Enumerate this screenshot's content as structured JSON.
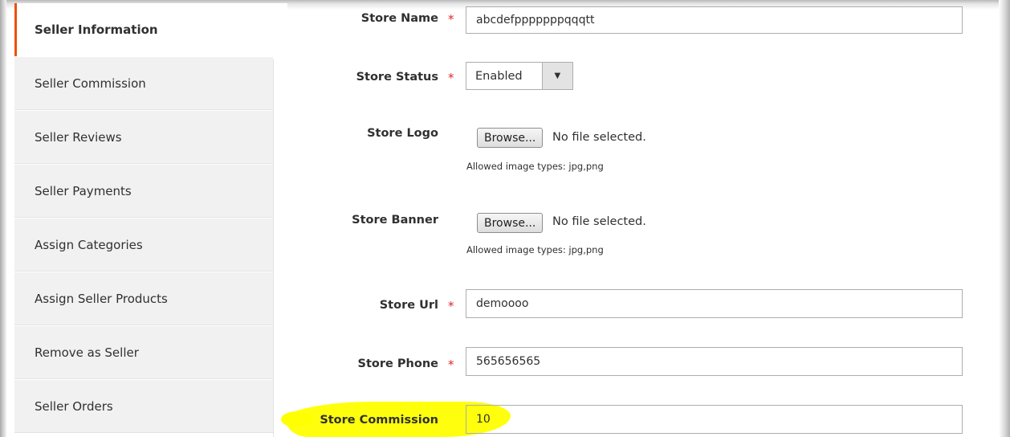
{
  "sidebar": {
    "items": [
      {
        "label": "Seller Information",
        "active": true
      },
      {
        "label": "Seller Commission"
      },
      {
        "label": "Seller Reviews"
      },
      {
        "label": "Seller Payments"
      },
      {
        "label": "Assign Categories"
      },
      {
        "label": "Assign Seller Products"
      },
      {
        "label": "Remove as Seller"
      },
      {
        "label": "Seller Orders"
      }
    ]
  },
  "form": {
    "store_name": {
      "label": "Store Name",
      "value": "abcdefpppppppqqqtt",
      "required": true
    },
    "store_status": {
      "label": "Store Status",
      "value": "Enabled",
      "required": true
    },
    "store_logo": {
      "label": "Store Logo",
      "button": "Browse...",
      "file_status": "No file selected.",
      "note": "Allowed image types: jpg,png"
    },
    "store_banner": {
      "label": "Store Banner",
      "button": "Browse...",
      "file_status": "No file selected.",
      "note": "Allowed image types: jpg,png"
    },
    "store_url": {
      "label": "Store Url",
      "value": "demoooo",
      "required": true
    },
    "store_phone": {
      "label": "Store Phone",
      "value": "565656565",
      "required": true
    },
    "store_commission": {
      "label": "Store Commission",
      "value": "10",
      "highlighted": true
    },
    "required_mark": "*"
  },
  "colors": {
    "accent": "#eb5202",
    "required": "#e22626",
    "highlight": "#ffff00",
    "sidebar_bg": "#f1f1f1"
  },
  "icons": {
    "select_arrow": "chevron-down-icon"
  }
}
